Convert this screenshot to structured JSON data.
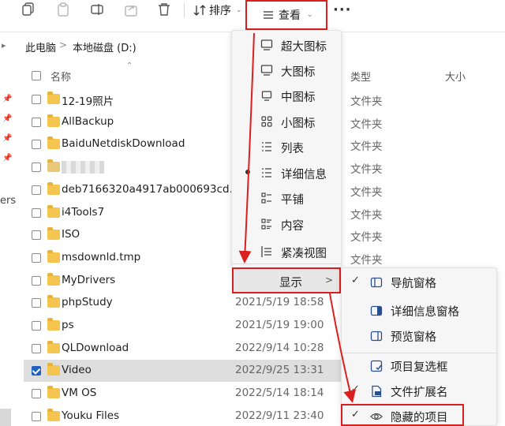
{
  "toolbar": {
    "sort_label": "排序",
    "view_label": "查看",
    "more_label": "···"
  },
  "address": {
    "crumbs": [
      "此电脑",
      "本地磁盘 (D:)"
    ],
    "separator": ">"
  },
  "nav": {
    "partial_text": "ers"
  },
  "columns": {
    "name": "名称",
    "type": "类型",
    "size": "大小"
  },
  "files": [
    {
      "name": "12-19照片",
      "date": "",
      "type": "文件夹",
      "selected": false
    },
    {
      "name": "AllBackup",
      "date": "",
      "type": "文件夹",
      "selected": false
    },
    {
      "name": "BaiduNetdiskDownload",
      "date": "",
      "type": "文件夹",
      "selected": false
    },
    {
      "name": "",
      "date": "",
      "type": "文件夹",
      "selected": false,
      "obscured": true
    },
    {
      "name": "deb7166320a4917ab000693cd...",
      "date": "",
      "type": "文件夹",
      "selected": false
    },
    {
      "name": "i4Tools7",
      "date": "",
      "type": "文件夹",
      "selected": false
    },
    {
      "name": "ISO",
      "date": "",
      "type": "文件夹",
      "selected": false
    },
    {
      "name": "msdownld.tmp",
      "date": "",
      "type": "文件夹",
      "selected": false
    },
    {
      "name": "MyDrivers",
      "date": "",
      "type": "",
      "selected": false
    },
    {
      "name": "phpStudy",
      "date": "2021/5/19 18:58",
      "type": "",
      "selected": false
    },
    {
      "name": "ps",
      "date": "2021/5/19 19:00",
      "type": "",
      "selected": false
    },
    {
      "name": "QLDownload",
      "date": "2022/9/14 10:28",
      "type": "",
      "selected": false
    },
    {
      "name": "Video",
      "date": "2022/9/25 13:31",
      "type": "",
      "selected": true
    },
    {
      "name": "VM OS",
      "date": "2022/5/14 18:14",
      "type": "",
      "selected": false
    },
    {
      "name": "Youku Files",
      "date": "2022/9/11 23:40",
      "type": "",
      "selected": false
    }
  ],
  "view_menu": {
    "items": [
      {
        "label": "超大图标",
        "icon": "monitor-icon",
        "active": false
      },
      {
        "label": "大图标",
        "icon": "monitor-icon",
        "active": false
      },
      {
        "label": "中图标",
        "icon": "monitor-icon",
        "active": false
      },
      {
        "label": "小图标",
        "icon": "small-grid-icon",
        "active": false
      },
      {
        "label": "列表",
        "icon": "list-icon",
        "active": false
      },
      {
        "label": "详细信息",
        "icon": "details-icon",
        "active": true
      },
      {
        "label": "平铺",
        "icon": "tiles-icon",
        "active": false
      },
      {
        "label": "内容",
        "icon": "content-icon",
        "active": false
      },
      {
        "label": "紧凑视图",
        "icon": "compact-icon",
        "active": false
      }
    ],
    "show_label": "显示",
    "show_arrow": ">"
  },
  "show_menu": {
    "items": [
      {
        "label": "导航窗格",
        "icon": "nav-pane-icon",
        "checked": true
      },
      {
        "label": "详细信息窗格",
        "icon": "details-pane-icon",
        "checked": false
      },
      {
        "label": "预览窗格",
        "icon": "preview-pane-icon",
        "checked": false
      },
      {
        "label": "项目复选框",
        "icon": "item-checkbox-icon",
        "checked": false
      },
      {
        "label": "文件扩展名",
        "icon": "file-ext-icon",
        "checked": true
      },
      {
        "label": "隐藏的项目",
        "icon": "eye-icon",
        "checked": true
      }
    ]
  },
  "colors": {
    "highlight": "#d9201f",
    "folder": "#f4c54f",
    "checkbox_checked": "#1f5fbf"
  }
}
